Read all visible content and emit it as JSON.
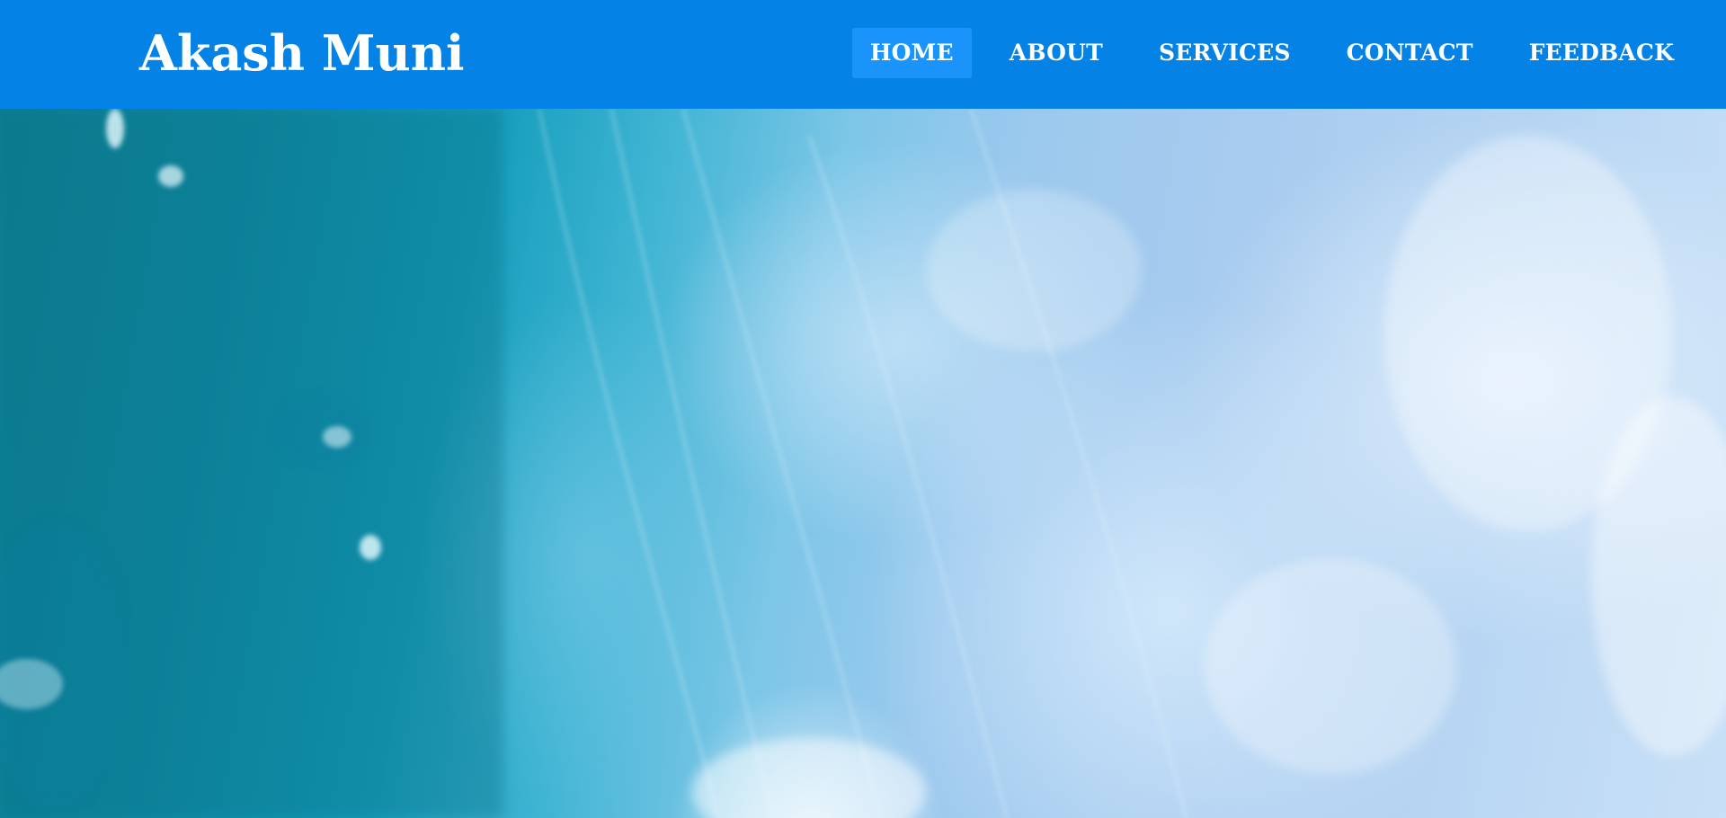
{
  "brand": {
    "name": "Akash Muni"
  },
  "nav": {
    "items": [
      {
        "label": "HOME",
        "active": true
      },
      {
        "label": "ABOUT",
        "active": false
      },
      {
        "label": "SERVICES",
        "active": false
      },
      {
        "label": "CONTACT",
        "active": false
      },
      {
        "label": "FEEDBACK",
        "active": false
      }
    ]
  },
  "colors": {
    "navbar": "#0482e6",
    "nav_active": "#1a93fb",
    "text": "#ffffff"
  },
  "hero": {
    "image": "ocean-wave-photo"
  }
}
